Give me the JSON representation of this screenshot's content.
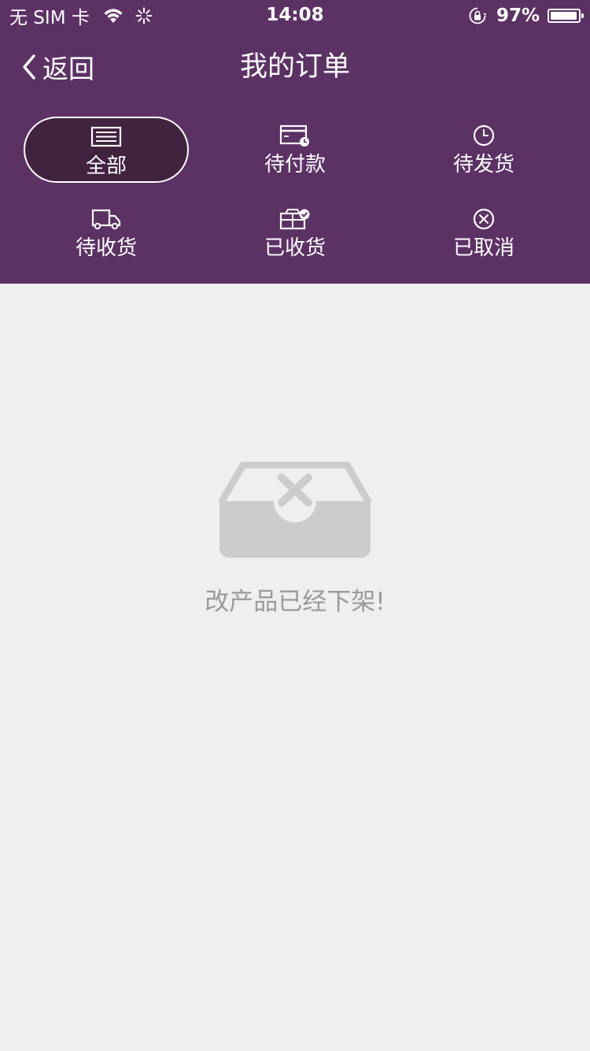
{
  "status_bar": {
    "carrier": "无 SIM 卡",
    "time": "14:08",
    "battery_percent": "97%",
    "battery_level": 0.97,
    "wifi_icon": "wifi-icon",
    "activity_icon": "activity-spinner-icon",
    "lock_icon": "rotation-lock-icon"
  },
  "nav": {
    "back_label": "返回",
    "title": "我的订单"
  },
  "tabs": [
    {
      "label": "全部",
      "icon": "list-icon",
      "active": true
    },
    {
      "label": "待付款",
      "icon": "card-clock-icon",
      "active": false
    },
    {
      "label": "待发货",
      "icon": "clock-icon",
      "active": false
    },
    {
      "label": "待收货",
      "icon": "truck-icon",
      "active": false
    },
    {
      "label": "已收货",
      "icon": "box-check-icon",
      "active": false
    },
    {
      "label": "已取消",
      "icon": "circle-x-icon",
      "active": false
    }
  ],
  "empty_state": {
    "icon": "empty-tray-icon",
    "message": "改产品已经下架!"
  },
  "colors": {
    "header_bg": "#5c3265",
    "active_tab_bg": "#41223f",
    "page_bg": "#efefef",
    "empty_icon": "#cccccc",
    "empty_text": "#9a9a9a"
  }
}
